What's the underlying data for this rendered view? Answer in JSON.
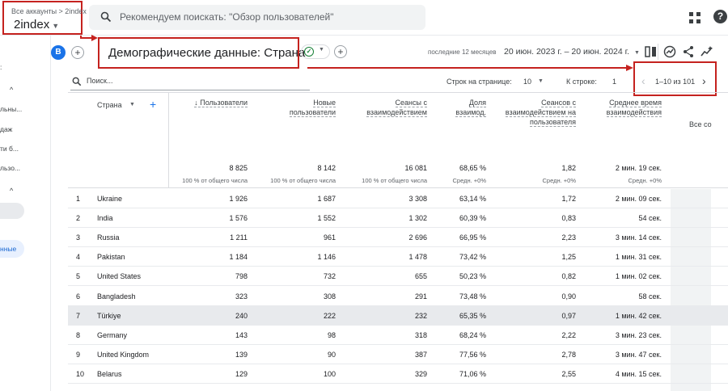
{
  "header": {
    "breadcrumb": "Все аккаунты > 2index",
    "property": "2index",
    "search_placeholder": "Рекомендуем поискать: \"Обзор пользователей\""
  },
  "sidebar": {
    "items": [
      "льны...",
      "даж",
      "ти б...",
      "льзо...",
      "нные"
    ]
  },
  "report": {
    "avatar": "B",
    "title": "Демографические данные: Страна",
    "period_label": "последние 12 месяцев",
    "date_range": "20 июн. 2023 г. – 20 июн. 2024 г."
  },
  "controls": {
    "search_label": "Поиск...",
    "rows_per_page_label": "Строк на странице:",
    "rows_per_page": "10",
    "goto_row_label": "К строке:",
    "goto_row": "1",
    "pagination": "1–10 из 101"
  },
  "table": {
    "dimension_header": "Страна",
    "columns": [
      {
        "label": "↓ Пользователи",
        "total": "8 825",
        "sub": "100 % от общего числа"
      },
      {
        "label": "Новые пользователи",
        "total": "8 142",
        "sub": "100 % от общего числа"
      },
      {
        "label": "Сеансы с взаимодействием",
        "total": "16 081",
        "sub": "100 % от общего числа"
      },
      {
        "label": "Доля взаимод.",
        "total": "68,65 %",
        "sub": "Средн. +0%"
      },
      {
        "label": "Сеансов с взаимодействием на пользователя",
        "total": "1,82",
        "sub": "Средн. +0%"
      },
      {
        "label": "Среднее время взаимодействия",
        "total": "2 мин. 19 сек.",
        "sub": "Средн. +0%"
      },
      {
        "label": "Все со",
        "total": "",
        "sub": ""
      }
    ],
    "rows": [
      {
        "n": "1",
        "country": "Ukraine",
        "users": "1 926",
        "new": "1 687",
        "eng": "3 308",
        "rate": "63,14 %",
        "per": "1,72",
        "time": "2 мин. 09 сек."
      },
      {
        "n": "2",
        "country": "India",
        "users": "1 576",
        "new": "1 552",
        "eng": "1 302",
        "rate": "60,39 %",
        "per": "0,83",
        "time": "54 сек."
      },
      {
        "n": "3",
        "country": "Russia",
        "users": "1 211",
        "new": "961",
        "eng": "2 696",
        "rate": "66,95 %",
        "per": "2,23",
        "time": "3 мин. 14 сек."
      },
      {
        "n": "4",
        "country": "Pakistan",
        "users": "1 184",
        "new": "1 146",
        "eng": "1 478",
        "rate": "73,42 %",
        "per": "1,25",
        "time": "1 мин. 31 сек."
      },
      {
        "n": "5",
        "country": "United States",
        "users": "798",
        "new": "732",
        "eng": "655",
        "rate": "50,23 %",
        "per": "0,82",
        "time": "1 мин. 02 сек."
      },
      {
        "n": "6",
        "country": "Bangladesh",
        "users": "323",
        "new": "308",
        "eng": "291",
        "rate": "73,48 %",
        "per": "0,90",
        "time": "58 сек."
      },
      {
        "n": "7",
        "country": "Türkiye",
        "users": "240",
        "new": "222",
        "eng": "232",
        "rate": "65,35 %",
        "per": "0,97",
        "time": "1 мин. 42 сек."
      },
      {
        "n": "8",
        "country": "Germany",
        "users": "143",
        "new": "98",
        "eng": "318",
        "rate": "68,24 %",
        "per": "2,22",
        "time": "3 мин. 23 сек."
      },
      {
        "n": "9",
        "country": "United Kingdom",
        "users": "139",
        "new": "90",
        "eng": "387",
        "rate": "77,56 %",
        "per": "2,78",
        "time": "3 мин. 47 сек."
      },
      {
        "n": "10",
        "country": "Belarus",
        "users": "129",
        "new": "100",
        "eng": "329",
        "rate": "71,06 %",
        "per": "2,55",
        "time": "4 мин. 15 сек."
      }
    ]
  },
  "colors": {
    "accent": "#1a73e8",
    "annotation": "#c5221f",
    "highlight_row": "#e8eaed"
  }
}
